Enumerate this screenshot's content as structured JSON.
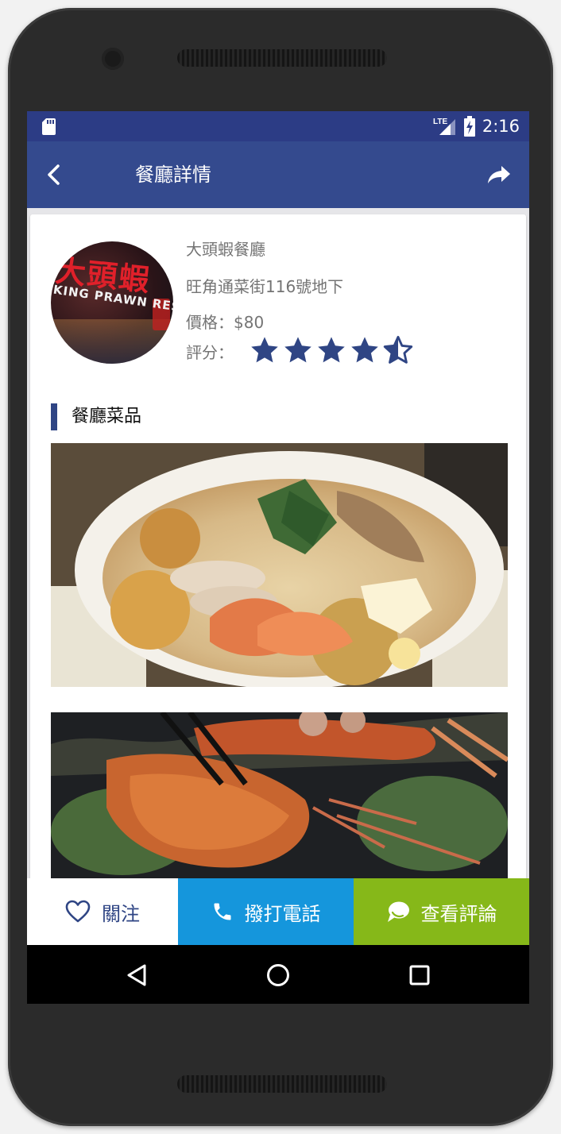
{
  "status_bar": {
    "time": "2:16",
    "network": "LTE",
    "icons": [
      "sd-card-icon",
      "signal-icon",
      "battery-charging-icon"
    ]
  },
  "app_bar": {
    "title": "餐廳詳情",
    "icons": [
      "back-arrow-icon",
      "share-icon"
    ]
  },
  "restaurant": {
    "avatar_sign_text": "大頭蝦",
    "avatar_sign_en": "KING PRAWN RESTAUR",
    "name": "大頭蝦餐廳",
    "address": "旺角通菜街116號地下",
    "price_label": "價格：",
    "price": "$80",
    "rating_label": "評分：",
    "rating": 4.5,
    "rating_max": 5
  },
  "dishes_section": {
    "title": "餐廳菜品",
    "items": [
      "laksa-noodle-dish-photo",
      "grilled-prawn-dish-photo"
    ]
  },
  "bottom_actions": {
    "follow": "關注",
    "call": "撥打電話",
    "reviews": "查看評論"
  },
  "nav_bar": {
    "icons": [
      "nav-back-icon",
      "nav-home-icon",
      "nav-recents-icon"
    ]
  },
  "colors": {
    "status_bar": "#2c3c85",
    "app_bar": "#344a8e",
    "accent": "#2f4584",
    "call": "#1596dc",
    "review": "#86b819"
  }
}
